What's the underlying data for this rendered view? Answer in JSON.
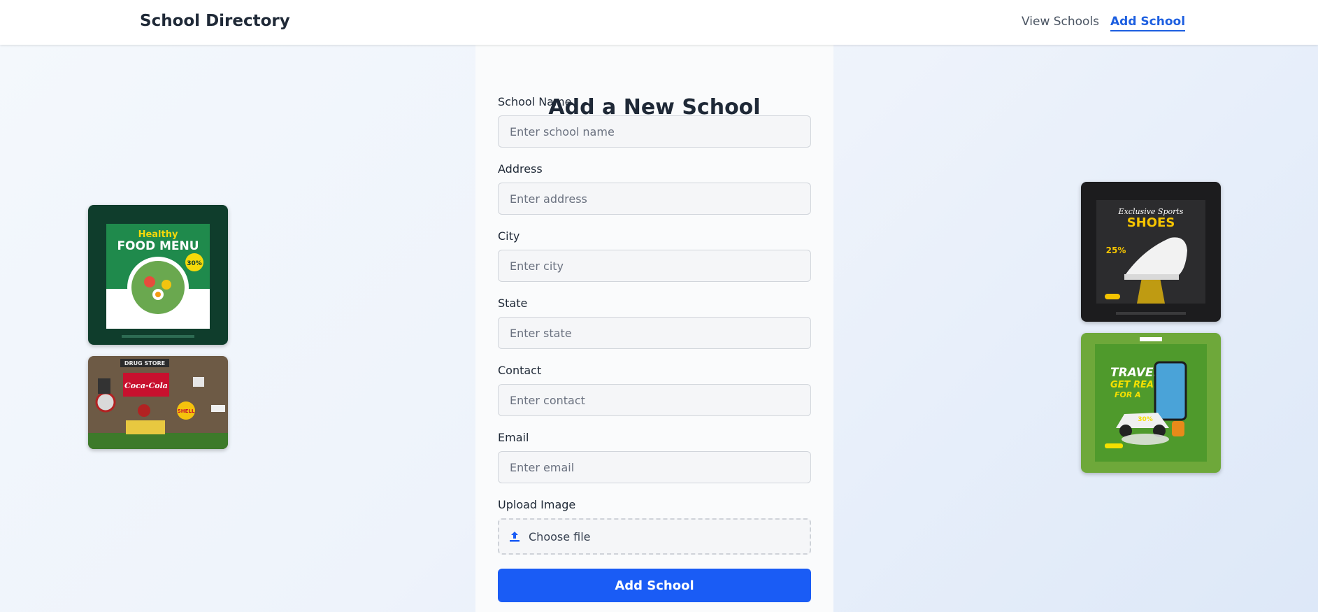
{
  "navbar": {
    "brand": "School Directory",
    "links": [
      "View Schools",
      "Add School"
    ]
  },
  "form": {
    "title": "Add a New School",
    "fields": [
      {
        "label": "School Name",
        "placeholder": "Enter school name"
      },
      {
        "label": "Address",
        "placeholder": "Enter address"
      },
      {
        "label": "City",
        "placeholder": "Enter city"
      },
      {
        "label": "State",
        "placeholder": "Enter state"
      },
      {
        "label": "Contact",
        "placeholder": "Enter contact"
      },
      {
        "label": "Email",
        "placeholder": "Enter email"
      }
    ],
    "upload_label": "Upload Image",
    "upload_text": "Choose file",
    "submit_label": "Add School"
  },
  "gallery": {
    "food": {
      "line1": "Healthy",
      "line2": "FOOD MENU",
      "badge": "30%"
    },
    "drug": {
      "sign": "Coca-Cola",
      "top": "DRUG STORE",
      "shell": "SHELL"
    },
    "shoes": {
      "script": "Exclusive Sports",
      "title": "SHOES",
      "discount": "25%"
    },
    "travel": {
      "line1": "TRAVEL",
      "line2": "GET READY",
      "line3": "FOR A",
      "discount": "30%"
    }
  },
  "colors": {
    "accent": "#1a5cf5",
    "link_active": "#1d5fe0",
    "food_bg": "#0f3d2c",
    "travel_bg": "#6ea83a",
    "shoes_bg": "#1c1c1e"
  }
}
